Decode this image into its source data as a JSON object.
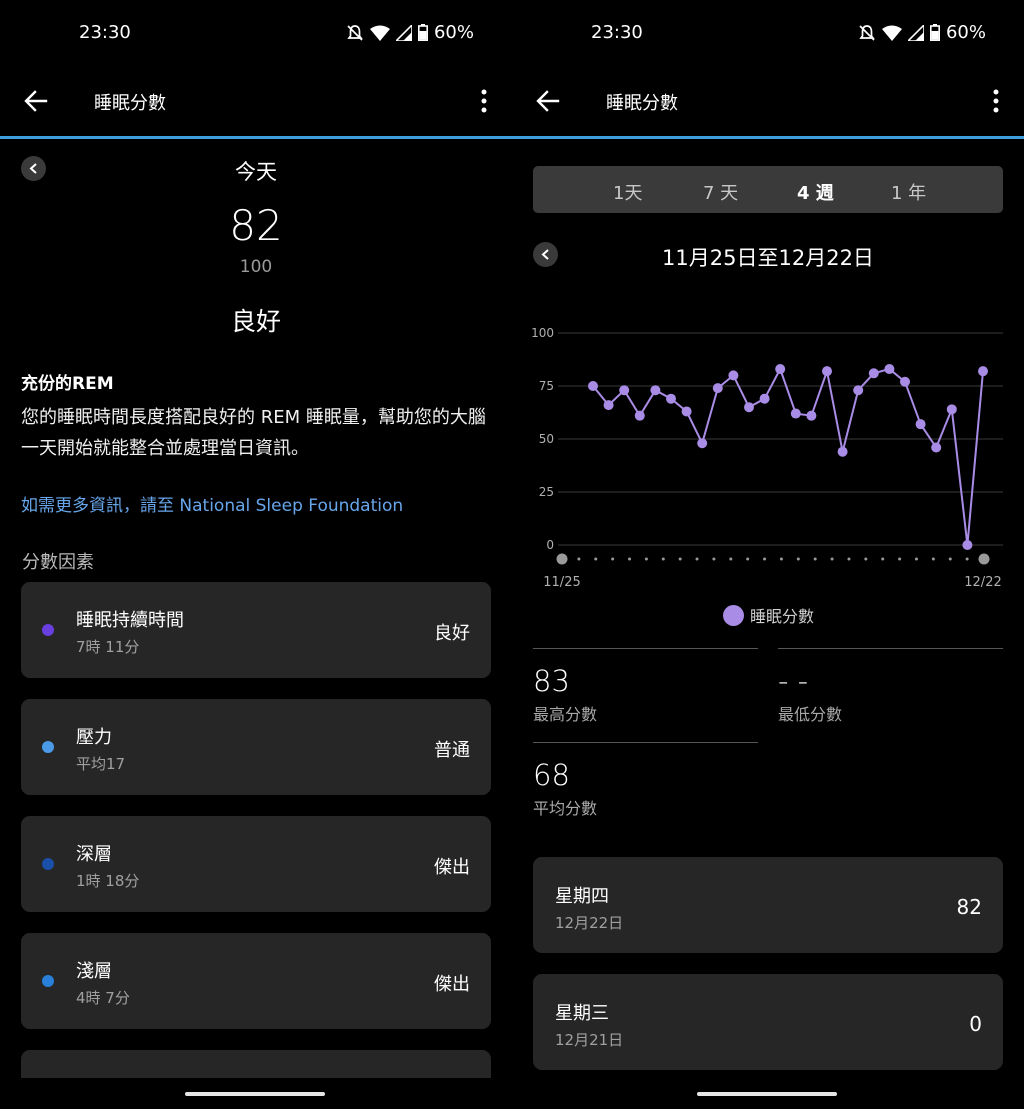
{
  "colors": {
    "accent_line": "#3fa0e0",
    "link": "#67a6ea",
    "chart_line": "#a98ce6",
    "duration_dot": "#6a3fe0",
    "stress_dot": "#4a9ae8",
    "deep_dot": "#1b4fa8",
    "light_dot": "#2a7fd8"
  },
  "status": {
    "time": "23:30",
    "battery": "60%"
  },
  "left": {
    "title": "睡眠分數",
    "day_label": "今天",
    "score": "82",
    "score_max": "100",
    "quality": "良好",
    "insight_title": "充份的REM",
    "insight_body": "您的睡眠時間長度搭配良好的 REM 睡眠量，幫助您的大腦一天開始就能整合並處理當日資訊。",
    "learn_more": "如需更多資訊，請至 National Sleep Foundation",
    "factors_heading": "分數因素",
    "factors": [
      {
        "name": "睡眠持續時間",
        "sub": "7時 11分",
        "rating": "良好"
      },
      {
        "name": "壓力",
        "sub": "平均17",
        "rating": "普通"
      },
      {
        "name": "深層",
        "sub": "1時 18分",
        "rating": "傑出"
      },
      {
        "name": "淺層",
        "sub": "4時 7分",
        "rating": "傑出"
      }
    ]
  },
  "right": {
    "title": "睡眠分數",
    "tabs": [
      "1天",
      "7 天",
      "4 週",
      "1 年"
    ],
    "active_tab": "4 週",
    "date_range": "11月25日至12月22日",
    "legend": "睡眠分數",
    "stats": {
      "max_value": "83",
      "max_label": "最高分數",
      "min_value": "- -",
      "min_label": "最低分數",
      "avg_value": "68",
      "avg_label": "平均分數"
    },
    "days": [
      {
        "name": "星期四",
        "date": "12月22日",
        "score": "82"
      },
      {
        "name": "星期三",
        "date": "12月21日",
        "score": "0"
      }
    ]
  },
  "chart_data": {
    "type": "line",
    "x_start_label": "11/25",
    "x_end_label": "12/22",
    "ylim": [
      0,
      100
    ],
    "yticks": [
      0,
      25,
      50,
      75,
      100
    ],
    "grid": true,
    "legend_placement": "bottom-center",
    "series": [
      {
        "name": "睡眠分數",
        "values": [
          75,
          66,
          73,
          61,
          73,
          69,
          63,
          48,
          74,
          80,
          65,
          69,
          83,
          62,
          61,
          82,
          44,
          73,
          81,
          83,
          77,
          57,
          46,
          64,
          0,
          82
        ]
      }
    ]
  }
}
